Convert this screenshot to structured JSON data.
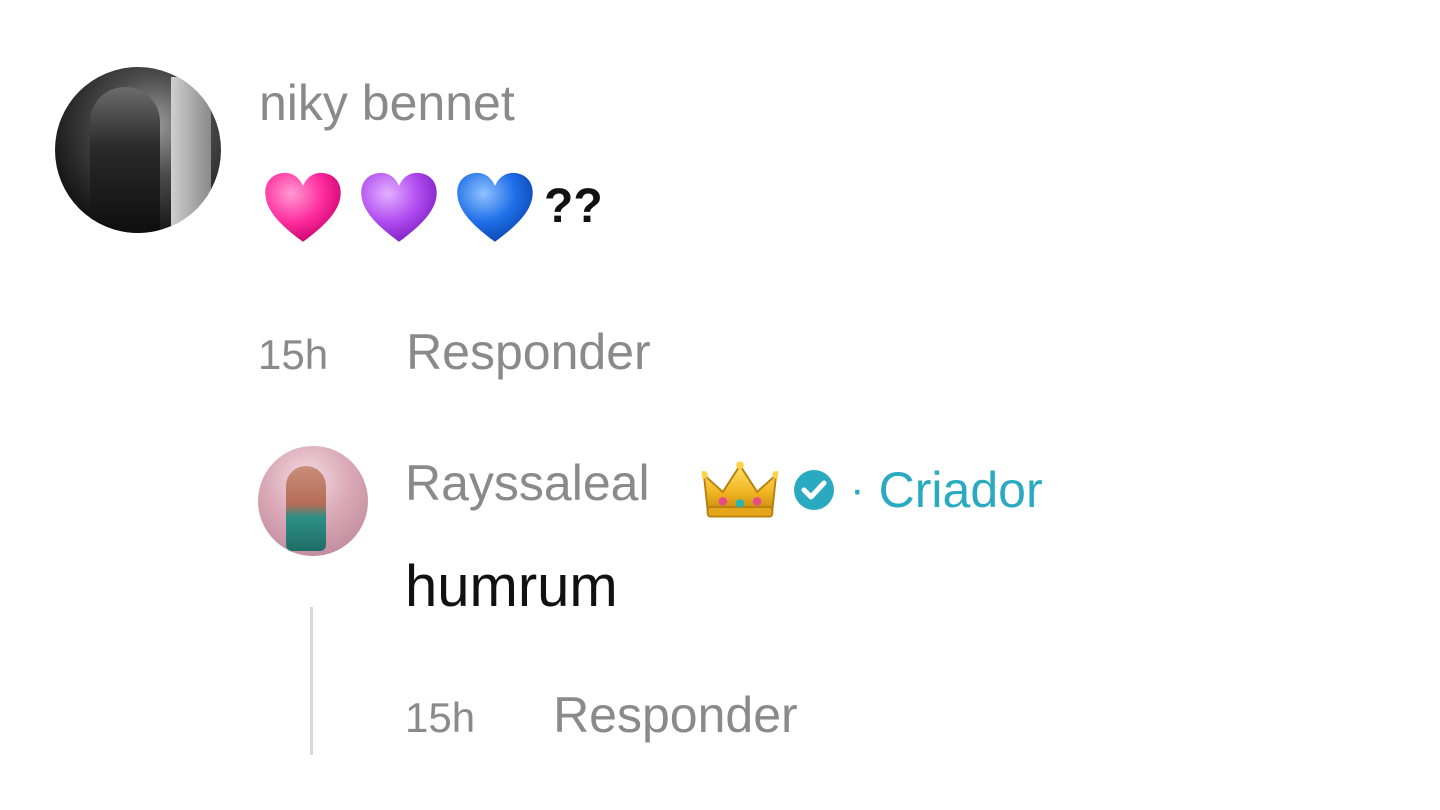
{
  "comment": {
    "username": "niky bennet",
    "hearts": [
      {
        "name": "pink-heart",
        "color": "#ff2d9e"
      },
      {
        "name": "purple-heart",
        "color": "#b14cf0"
      },
      {
        "name": "blue-heart",
        "color": "#1f6fe8"
      }
    ],
    "text_suffix": "??",
    "time": "15h",
    "reply_label": "Responder"
  },
  "reply": {
    "username": "Rayssaleal",
    "badge_icons": [
      "crown-icon",
      "verified-icon"
    ],
    "separator": "·",
    "role_label": "Criador",
    "text": "humrum",
    "time": "15h",
    "reply_label": "Responder"
  },
  "colors": {
    "muted_text": "#8a8a8a",
    "creator_accent": "#2aaac1",
    "body_text": "#111111"
  }
}
